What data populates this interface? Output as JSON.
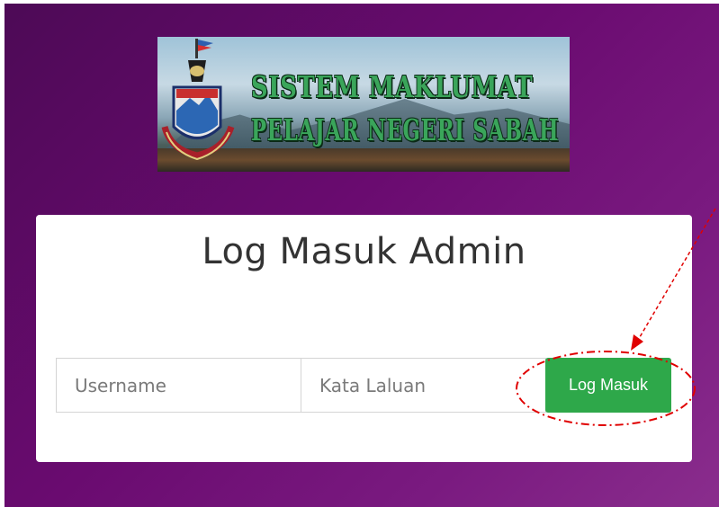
{
  "banner": {
    "line1": "SISTEM MAKLUMAT",
    "line2": "PELAJAR NEGERI SABAH"
  },
  "login": {
    "title": "Log Masuk Admin",
    "username_placeholder": "Username",
    "password_placeholder": "Kata Laluan",
    "submit_label": "Log Masuk"
  },
  "colors": {
    "background": "#6a0b70",
    "button": "#2ea84a",
    "annotation": "#e00000"
  }
}
